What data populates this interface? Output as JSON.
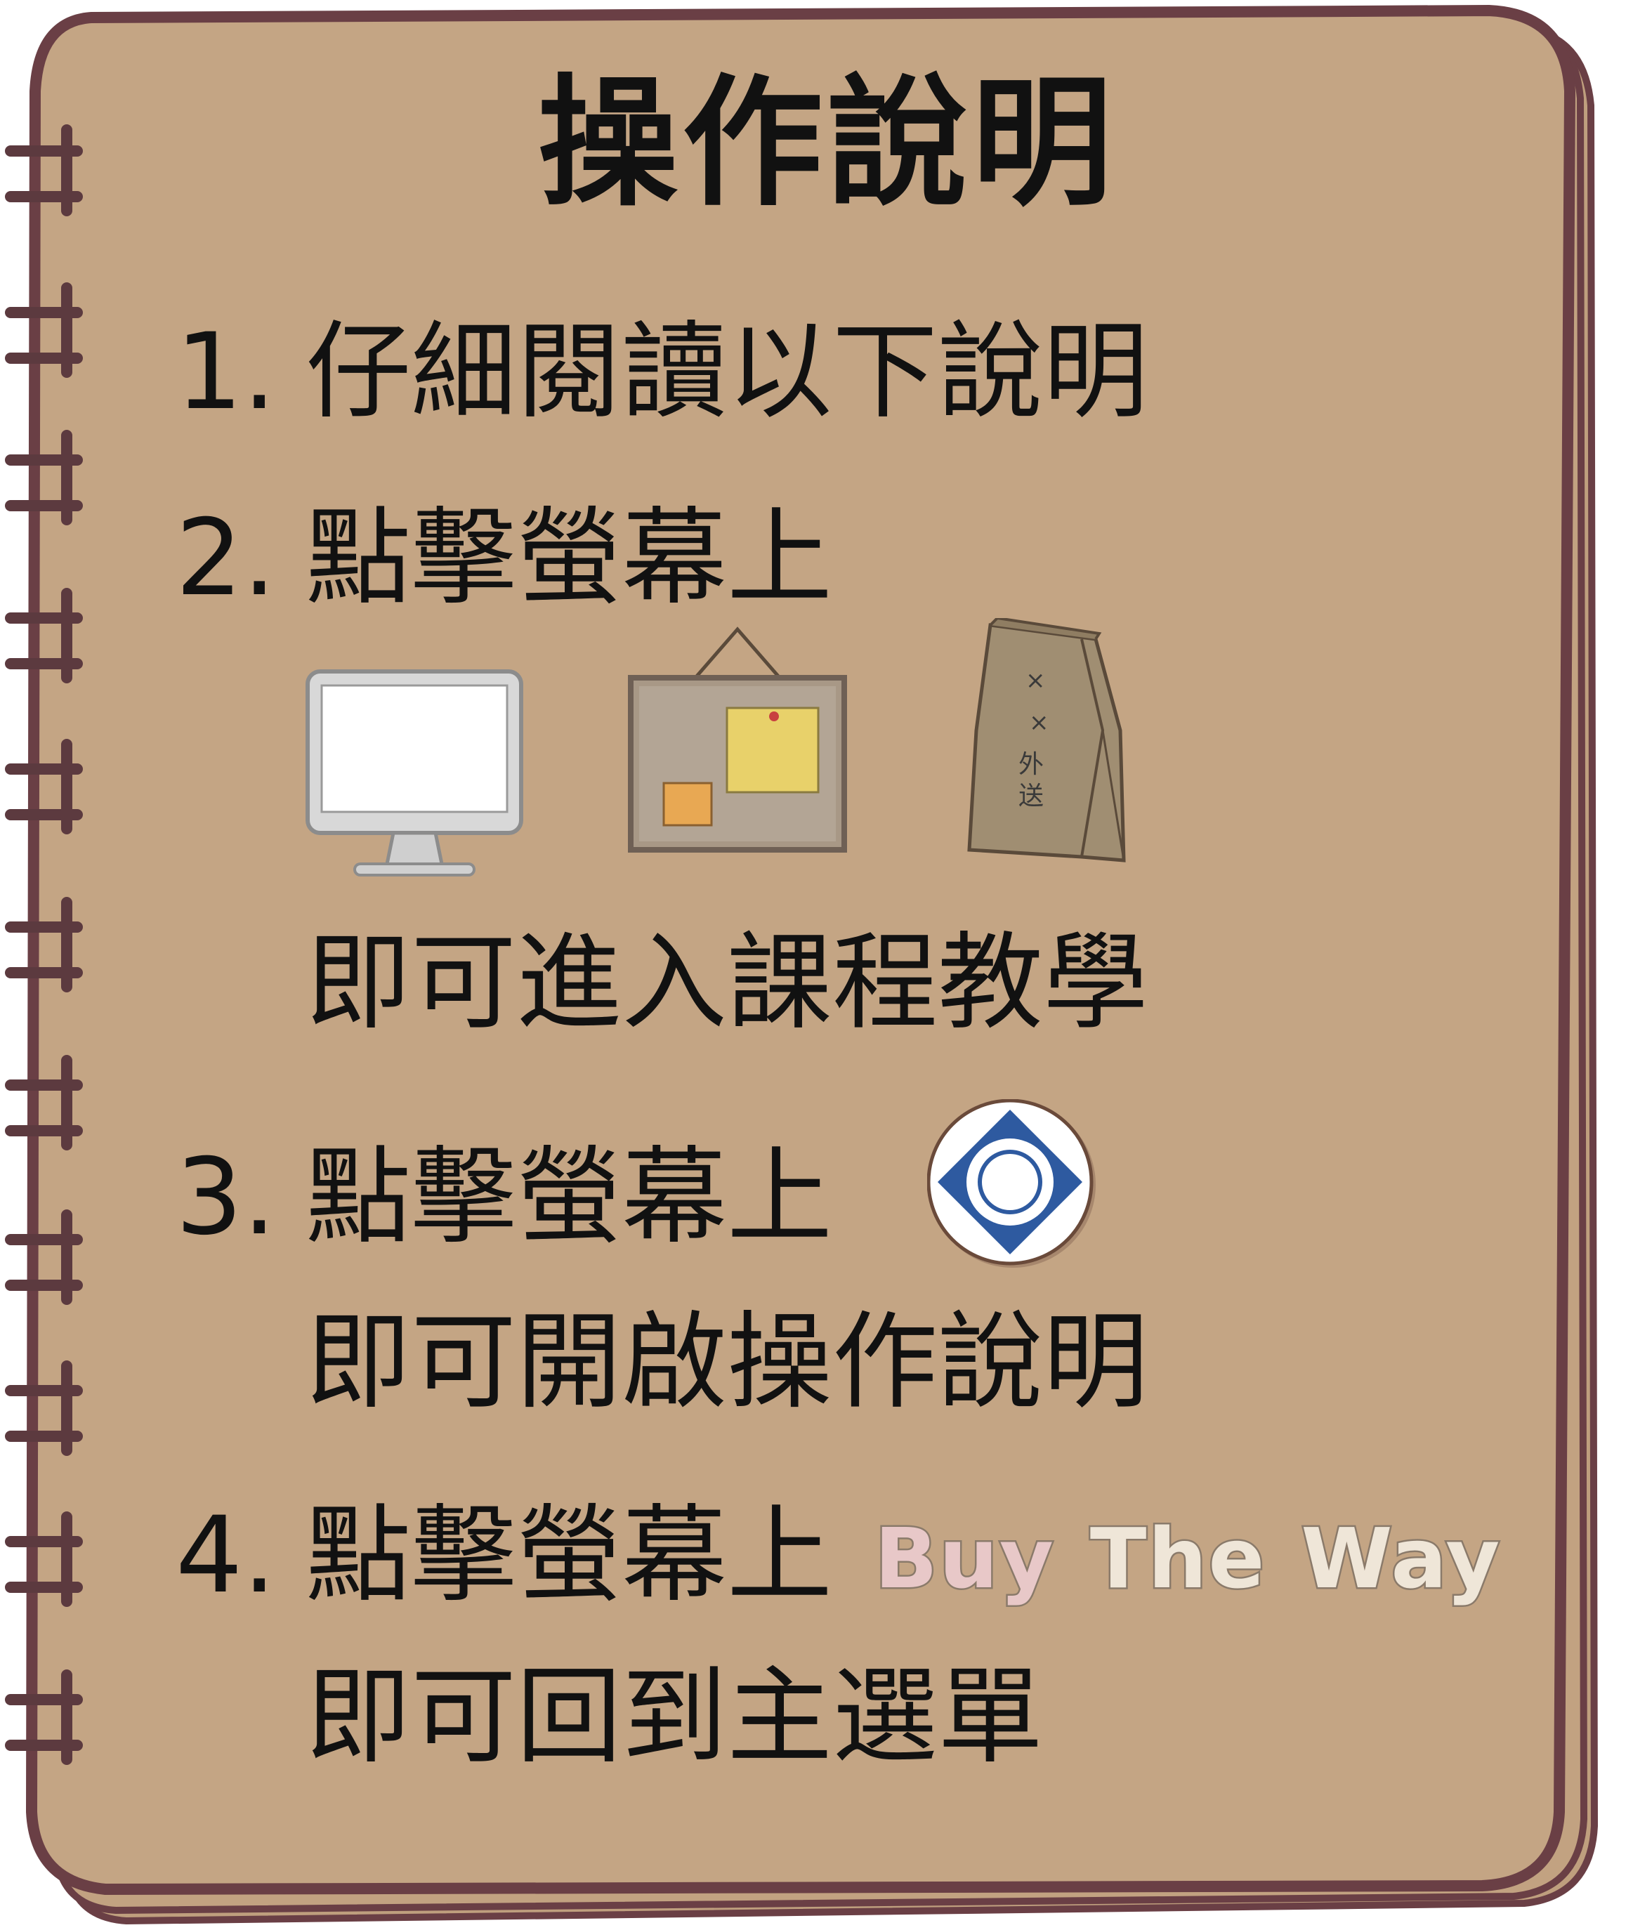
{
  "title": "操作說明",
  "steps": [
    {
      "num": "1.",
      "text": "仔細閱讀以下說明"
    },
    {
      "num": "2.",
      "text": "點擊螢幕上",
      "follow": "即可進入課程教學"
    },
    {
      "num": "3.",
      "text": "點擊螢幕上",
      "follow": "即可開啟操作說明"
    },
    {
      "num": "4.",
      "text": "點擊螢幕上",
      "follow": "即可回到主選單"
    }
  ],
  "logo": {
    "word1": "Buy",
    "word2": "The",
    "word3": "Way"
  },
  "bag_label": {
    "line1": "×",
    "line2": "×",
    "line3": "外",
    "line4": "送"
  },
  "icons": [
    "monitor-icon",
    "corkboard-icon",
    "takeout-bag-icon",
    "help-compass-icon"
  ],
  "colors": {
    "paper": "#c4a584",
    "border": "#6a3f45",
    "compass_blue": "#2e5aa0"
  }
}
